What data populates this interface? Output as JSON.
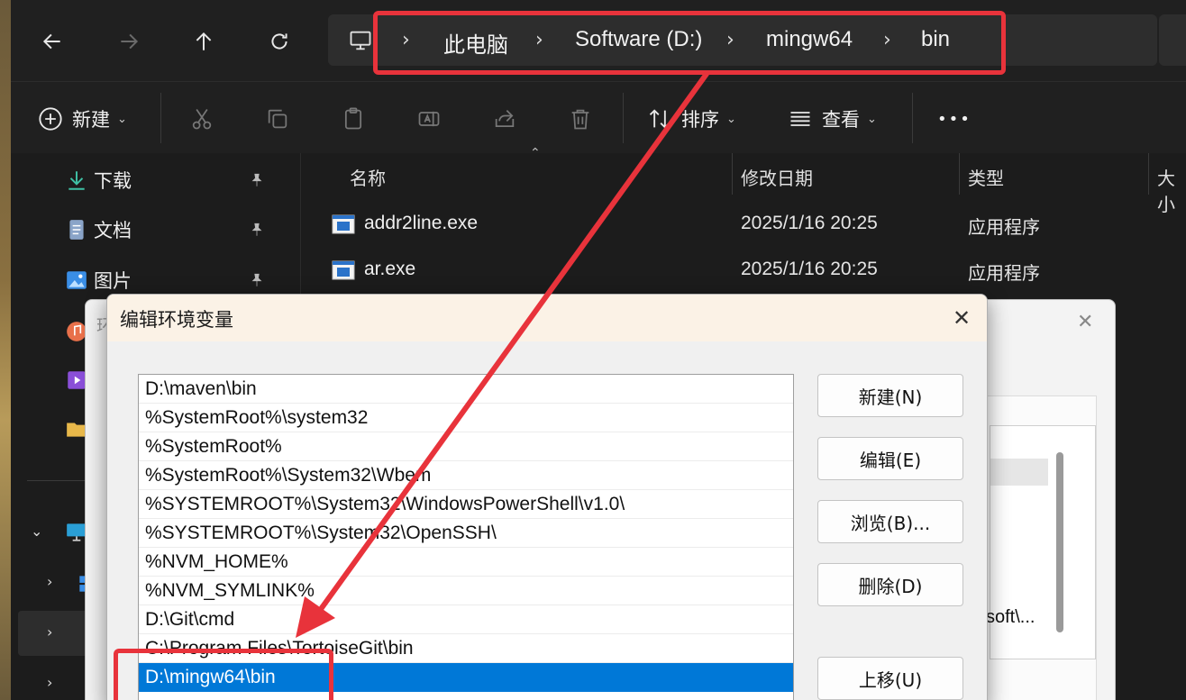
{
  "explorer": {
    "breadcrumbs": [
      "此电脑",
      "Software (D:)",
      "mingw64",
      "bin"
    ],
    "toolbar": {
      "new_label": "新建",
      "sort_label": "排序",
      "view_label": "查看",
      "more_label": "•••"
    },
    "sidebar": {
      "quick_access": [
        {
          "label": "下载",
          "icon": "download-icon"
        },
        {
          "label": "文档",
          "icon": "document-icon"
        },
        {
          "label": "图片",
          "icon": "pictures-icon"
        }
      ]
    },
    "columns": {
      "name": "名称",
      "date": "修改日期",
      "type": "类型",
      "size": "大小"
    },
    "files": [
      {
        "name": "addr2line.exe",
        "date": "2025/1/16 20:25",
        "type": "应用程序"
      },
      {
        "name": "ar.exe",
        "date": "2025/1/16 20:25",
        "type": "应用程序"
      }
    ]
  },
  "background_dialog": {
    "title": "环",
    "snippet": "soft\\..."
  },
  "dialog": {
    "title": "编辑环境变量",
    "close_glyph": "✕",
    "paths": [
      "D:\\maven\\bin",
      "%SystemRoot%\\system32",
      "%SystemRoot%",
      "%SystemRoot%\\System32\\Wbem",
      "%SYSTEMROOT%\\System32\\WindowsPowerShell\\v1.0\\",
      "%SYSTEMROOT%\\System32\\OpenSSH\\",
      "%NVM_HOME%",
      "%NVM_SYMLINK%",
      "D:\\Git\\cmd",
      "C:\\Program Files\\TortoiseGit\\bin",
      "D:\\mingw64\\bin",
      "..."
    ],
    "selected_path": "D:\\mingw64\\bin",
    "buttons": {
      "new": "新建(N)",
      "edit": "编辑(E)",
      "browse": "浏览(B)...",
      "delete": "删除(D)",
      "move_up": "上移(U)"
    }
  },
  "colors": {
    "annotation_red": "#e8333b",
    "selection_blue": "#0078d7"
  }
}
